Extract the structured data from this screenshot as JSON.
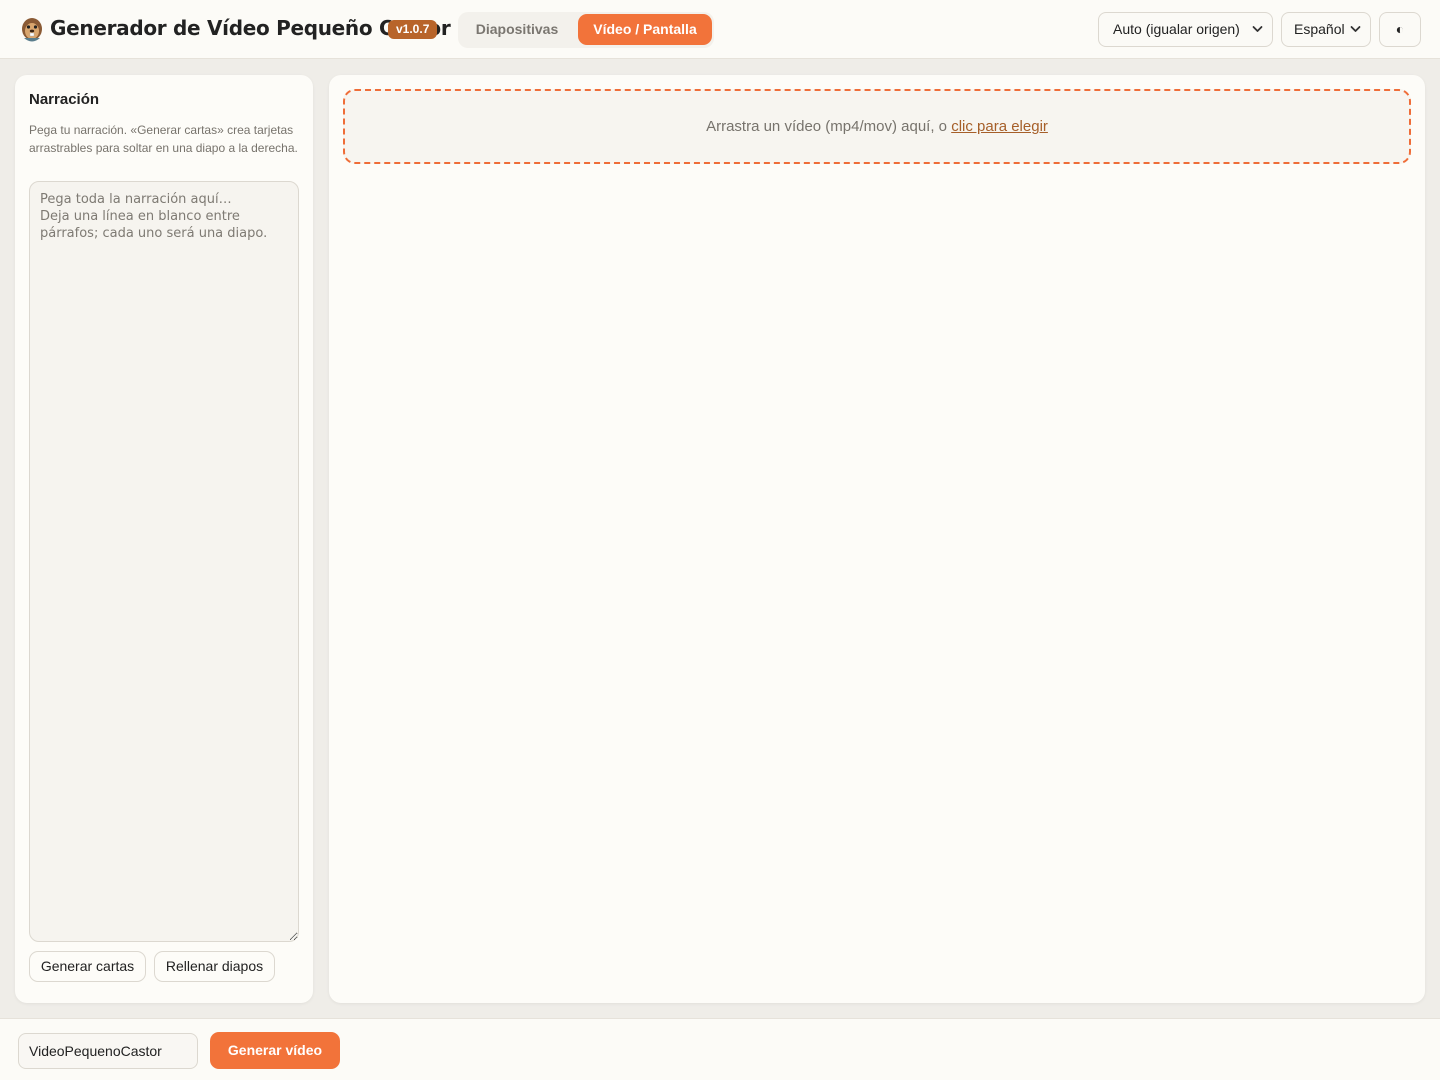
{
  "app": {
    "title": "Generador de Vídeo Pequeño Castor",
    "version": "v1.0.7",
    "logo_icon": "beaver-logo-icon"
  },
  "tabs": [
    {
      "label": "Diapositivas",
      "active": false
    },
    {
      "label": "Vídeo / Pantalla",
      "active": true
    }
  ],
  "header_controls": {
    "resolution_select": {
      "value": "Auto (igualar origen)"
    },
    "language_select": {
      "value": "Español"
    },
    "theme_toggle": {
      "glyph": "◐",
      "icon": "contrast-icon"
    }
  },
  "narration_panel": {
    "title": "Narración",
    "description": "Pega tu narración. «Generar cartas» crea tarjetas arrastrables para soltar en una diapo a la derecha.",
    "textarea": {
      "value": "",
      "placeholder": "Pega toda la narración aquí…\nDeja una línea en blanco entre párrafos; cada uno será una diapo."
    },
    "buttons": {
      "generate_cards": "Generar cartas",
      "fill_slides": "Rellenar diapos"
    }
  },
  "dropzone": {
    "text": "Arrastra un vídeo (mp4/mov) aquí, o ",
    "link": "clic para elegir"
  },
  "footer": {
    "filename_value": "VideoPequenoCastor",
    "generate_button": "Generar vídeo"
  },
  "colors": {
    "accent": "#f2733a",
    "version_badge": "#b8642a",
    "background": "#efede8",
    "panel": "#fdfcf8"
  }
}
